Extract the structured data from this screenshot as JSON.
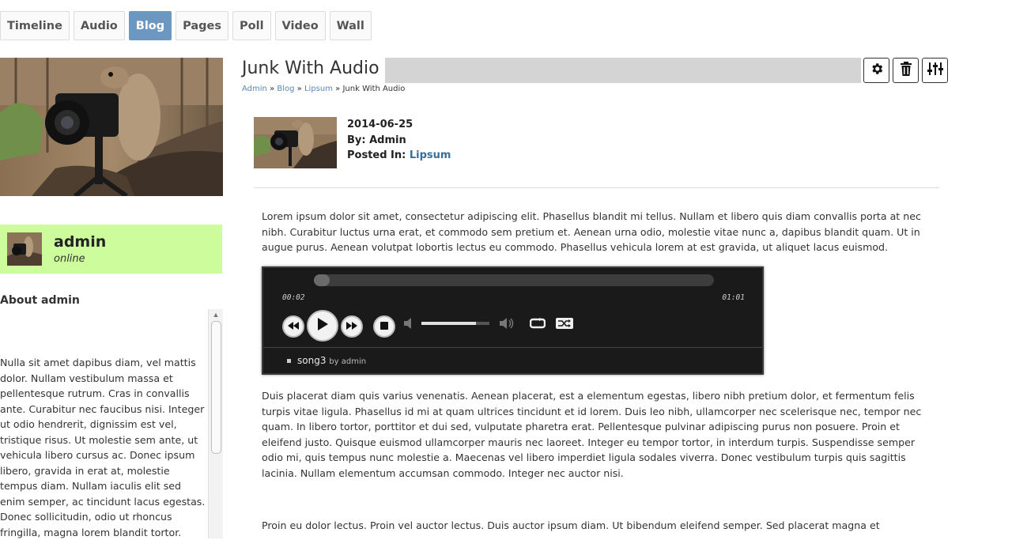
{
  "tabs": [
    {
      "label": "Timeline"
    },
    {
      "label": "Audio"
    },
    {
      "label": "Blog",
      "active": true
    },
    {
      "label": "Pages"
    },
    {
      "label": "Poll"
    },
    {
      "label": "Video"
    },
    {
      "label": "Wall"
    }
  ],
  "sidebar": {
    "user_name": "admin",
    "user_status": "online",
    "about_heading": "About admin",
    "about_text": "Nulla sit amet dapibus diam, vel mattis dolor. Nullam vestibulum massa et pellentesque rutrum. Cras in convallis ante. Curabitur nec faucibus nisi. Integer ut odio hendrerit, dignissim est vel, tristique risus. Ut molestie sem ante, ut vehicula libero cursus ac. Donec ipsum libero, gravida in erat at, molestie tempus diam. Nullam iaculis elit sed enim semper, ac tincidunt lacus egestas. Donec sollicitudin, odio ut rhoncus fringilla, magna lorem blandit tortor."
  },
  "page": {
    "title": "Junk With Audio",
    "breadcrumb": {
      "items": [
        "Admin",
        "Blog",
        "Lipsum"
      ],
      "separator": "»",
      "current": "Junk With Audio"
    },
    "tools": [
      {
        "icon": "gear-icon"
      },
      {
        "icon": "trash-icon"
      },
      {
        "icon": "sliders-icon"
      }
    ]
  },
  "post": {
    "date": "2014-06-25",
    "by_label": "By:",
    "author": "Admin",
    "posted_in_label": "Posted In:",
    "category": "Lipsum",
    "paragraph1": "Lorem ipsum dolor sit amet, consectetur adipiscing elit. Phasellus blandit mi tellus. Nullam et libero quis diam convallis porta at nec nibh. Curabitur luctus urna erat, et commodo sem pretium et. Aenean urna odio, molestie vitae nunc a, dapibus blandit quam. Ut in augue purus. Aenean volutpat lobortis lectus eu commodo. Phasellus vehicula lorem at est gravida, ut aliquet lacus euismod.",
    "paragraph2": "Duis placerat diam quis varius venenatis. Aenean placerat, est a elementum egestas, libero nibh pretium dolor, et fermentum felis turpis vitae ligula. Phasellus id mi at quam ultrices tincidunt et id lorem. Duis leo nibh, ullamcorper nec scelerisque nec, tempor nec quam. In libero tortor, porttitor et dui sed, vulputate pharetra erat. Pellentesque pulvinar adipiscing purus non posuere. Proin et eleifend justo. Quisque euismod ullamcorper mauris nec laoreet. Integer eu tempor tortor, in interdum turpis. Suspendisse semper odio mi, quis tempus nunc molestie a. Maecenas vel libero imperdiet ligula sodales viverra. Donec vestibulum turpis quis sagittis lacinia. Nullam elementum accumsan commodo. Integer nec auctor nisi.",
    "paragraph3": "Proin eu dolor lectus. Proin vel auctor lectus. Duis auctor ipsum diam. Ut bibendum eleifend semper. Sed placerat magna et"
  },
  "player": {
    "current_time": "00:02",
    "duration": "01:01",
    "progress_fraction": 0.04,
    "volume_fraction": 0.8,
    "track_title": "song3",
    "track_artist": "by admin"
  }
}
